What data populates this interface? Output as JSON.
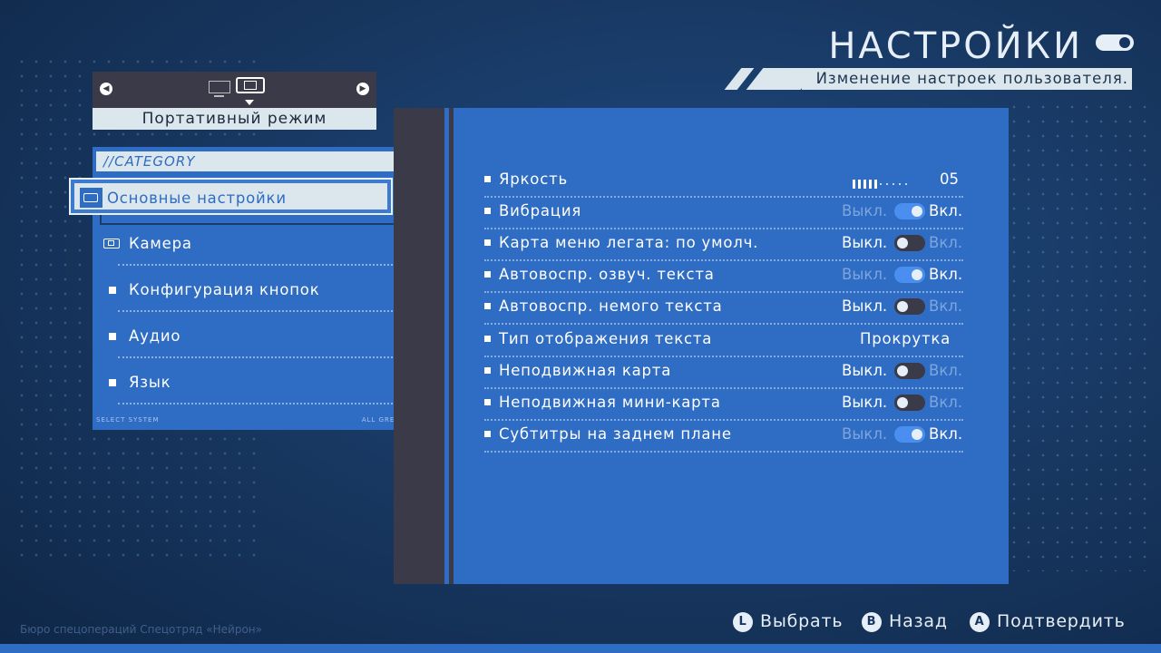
{
  "header": {
    "title": "НАСТРОЙКИ",
    "subtitle": "Изменение настроек пользователя."
  },
  "mode": {
    "label": "Портативный режим",
    "left_arrow": "◀",
    "right_arrow": "▶"
  },
  "category": {
    "header": "//CATEGORY",
    "items": [
      {
        "label": "Основные настройки",
        "selected": true,
        "icon": "handheld-icon"
      },
      {
        "label": "Камера",
        "icon": "handheld-icon"
      },
      {
        "label": "Конфигурация кнопок",
        "icon": "bullet"
      },
      {
        "label": "Аудио",
        "icon": "bullet"
      },
      {
        "label": "Язык",
        "icon": "bullet"
      }
    ],
    "footer_left": "SELECT SYSTEM",
    "footer_right": "ALL GREEN"
  },
  "settings": {
    "off_label": "Выкл.",
    "on_label": "Вкл.",
    "rows": [
      {
        "label": "Яркость",
        "type": "slider",
        "value": "05",
        "level": 5,
        "max": 10
      },
      {
        "label": "Вибрация",
        "type": "toggle",
        "state": "on"
      },
      {
        "label": "Карта меню легата: по умолч.",
        "type": "toggle",
        "state": "off"
      },
      {
        "label": "Автовоспр. озвуч. текста",
        "type": "toggle",
        "state": "on"
      },
      {
        "label": "Автовоспр. немого текста",
        "type": "toggle",
        "state": "off"
      },
      {
        "label": "Тип отображения текста",
        "type": "value",
        "value": "Прокрутка"
      },
      {
        "label": "Неподвижная карта",
        "type": "toggle",
        "state": "off"
      },
      {
        "label": "Неподвижная мини-карта",
        "type": "toggle",
        "state": "off"
      },
      {
        "label": "Субтитры на заднем плане",
        "type": "toggle",
        "state": "on"
      }
    ]
  },
  "hints": {
    "select": {
      "button": "L",
      "label": "Выбрать"
    },
    "back": {
      "button": "B",
      "label": "Назад"
    },
    "confirm": {
      "button": "A",
      "label": "Подтвердить"
    }
  },
  "corner": "Бюро спецопераций  Спецотряд «Нейрон»"
}
